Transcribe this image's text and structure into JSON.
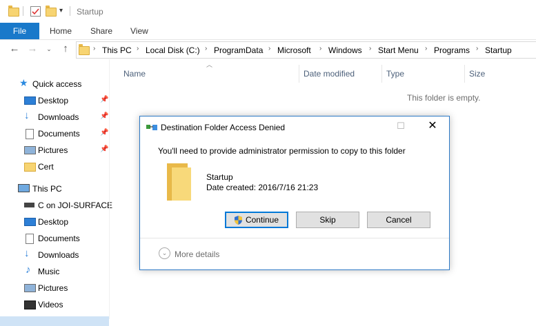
{
  "window": {
    "title": "Startup"
  },
  "ribbon": {
    "tabs": [
      "File",
      "Home",
      "Share",
      "View"
    ]
  },
  "address": {
    "crumbs": [
      "This PC",
      "Local Disk (C:)",
      "ProgramData",
      "Microsoft",
      "Windows",
      "Start Menu",
      "Programs",
      "Startup"
    ]
  },
  "sidebar": {
    "quick_access": "Quick access",
    "quick_items": [
      "Desktop",
      "Downloads",
      "Documents",
      "Pictures",
      "Cert"
    ],
    "this_pc": "This PC",
    "pc_items": [
      "C on JOI-SURFACE",
      "Desktop",
      "Documents",
      "Downloads",
      "Music",
      "Pictures",
      "Videos"
    ]
  },
  "columns": {
    "name": "Name",
    "date": "Date modified",
    "type": "Type",
    "size": "Size"
  },
  "content": {
    "empty": "This folder is empty."
  },
  "dialog": {
    "title": "Destination Folder Access Denied",
    "message": "You'll need to provide administrator permission to copy to this folder",
    "folder_name": "Startup",
    "date_created": "Date created: 2016/7/16 21:23",
    "buttons": {
      "continue": "Continue",
      "skip": "Skip",
      "cancel": "Cancel"
    },
    "more_details": "More details"
  },
  "colors": {
    "accent": "#1979ca",
    "dialog_border": "#2b78c5",
    "folder": "#f7d472"
  }
}
